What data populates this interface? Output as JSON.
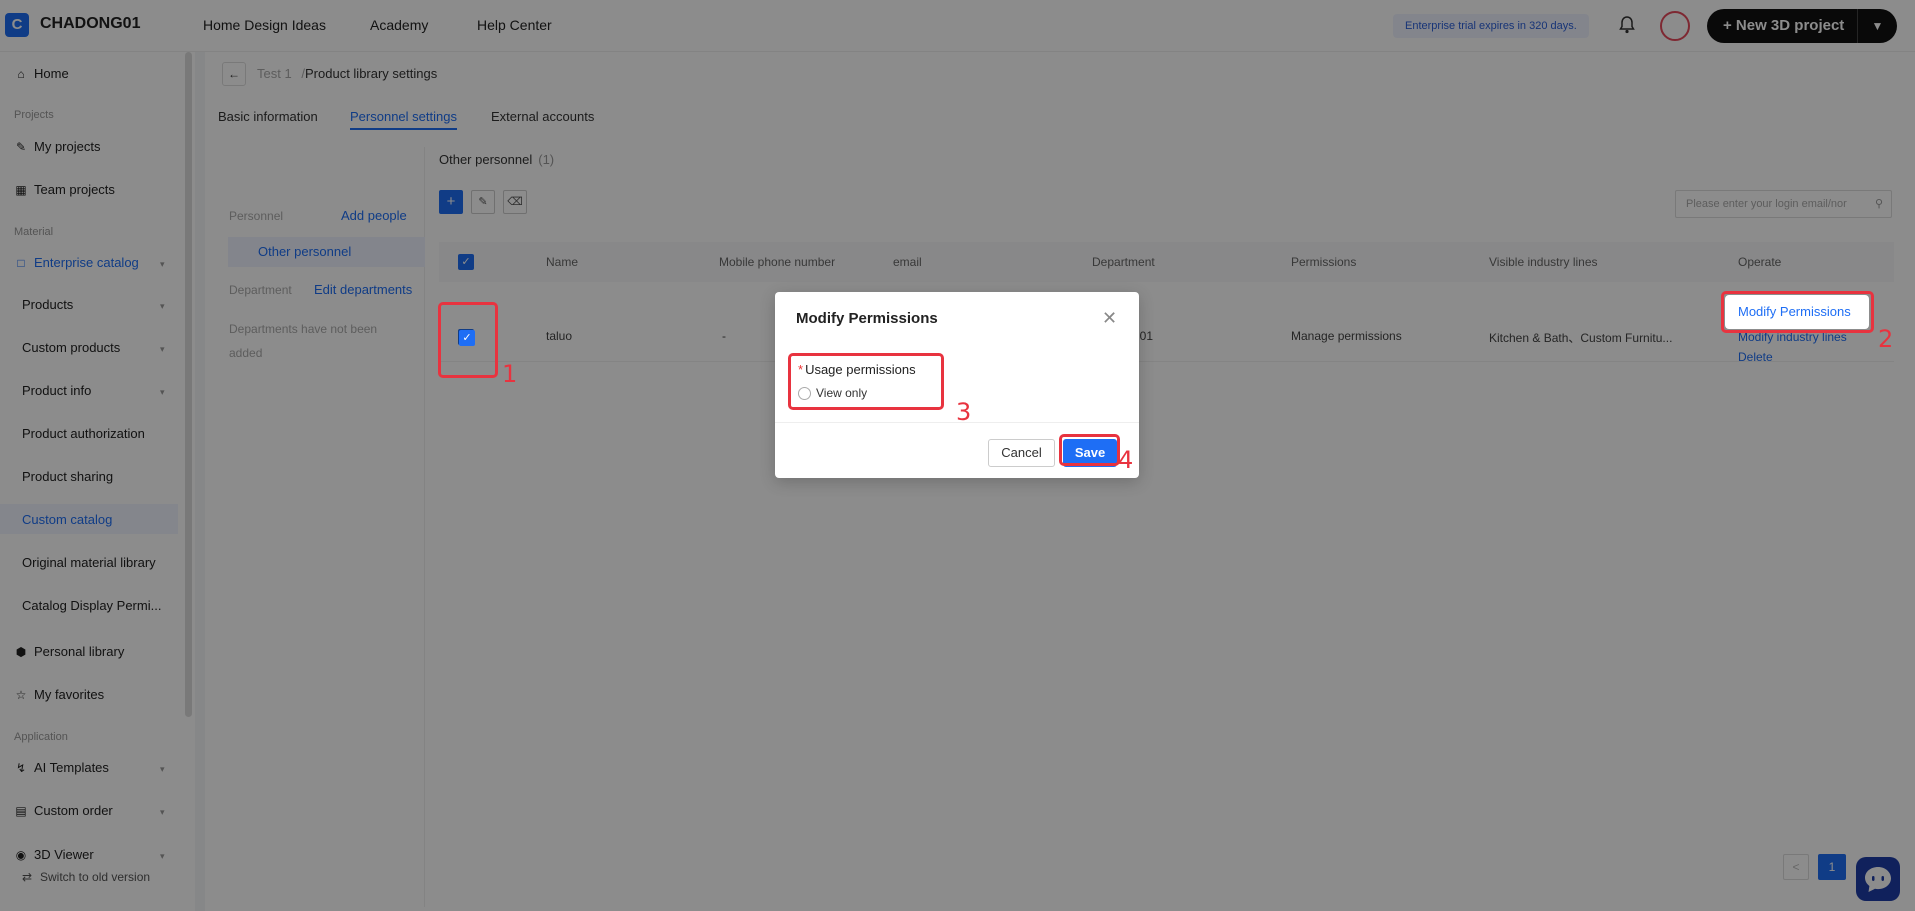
{
  "topbar": {
    "logo_letter": "C",
    "brand": "CHADONG01",
    "nav": [
      "Home Design Ideas",
      "Academy",
      "Help Center"
    ],
    "trial_notice": "Enterprise trial expires in 320 days.",
    "new_project_label": "+ New 3D project"
  },
  "sidebar": {
    "home": "Home",
    "section_projects": "Projects",
    "my_projects": "My projects",
    "team_projects": "Team projects",
    "section_material": "Material",
    "enterprise_catalog": "Enterprise catalog",
    "products": "Products",
    "custom_products": "Custom products",
    "product_info": "Product info",
    "product_authorization": "Product authorization",
    "product_sharing": "Product sharing",
    "custom_catalog": "Custom catalog",
    "original_material_library": "Original material library",
    "catalog_display": "Catalog Display Permi...",
    "personal_library": "Personal library",
    "my_favorites": "My favorites",
    "section_application": "Application",
    "ai_templates": "AI Templates",
    "custom_order": "Custom order",
    "viewer_3d": "3D Viewer",
    "switch_old": "Switch to old version"
  },
  "breadcrumb": {
    "parent": "Test 1",
    "separator": "/",
    "current": "Product library settings"
  },
  "tabs": [
    "Basic information",
    "Personnel settings",
    "External accounts"
  ],
  "left_panel": {
    "personnel_label": "Personnel",
    "add_people": "Add people",
    "other_personnel": "Other personnel",
    "department_label": "Department",
    "edit_departments": "Edit departments",
    "empty_departments": "Departments have not been added"
  },
  "group": {
    "title": "Other personnel",
    "count": "(1)"
  },
  "search": {
    "placeholder": "Please enter your login email/nor"
  },
  "table": {
    "headers": [
      "Name",
      "Mobile phone number",
      "email",
      "Department",
      "Permissions",
      "Visible industry lines",
      "Operate"
    ],
    "row": {
      "name": "taluo",
      "mobile": "-",
      "department": "g01",
      "permissions": "Manage permissions",
      "industry_lines": "Kitchen & Bath、Custom Furnitu...",
      "op_modify_permissions": "Modify Permissions",
      "op_modify_industry": "Modify industry lines",
      "op_delete": "Delete"
    }
  },
  "pager": {
    "prev": "<",
    "current": "1"
  },
  "modal": {
    "title": "Modify Permissions",
    "close": "✕",
    "required_mark": "*",
    "label": "Usage permissions",
    "option": "View only",
    "cancel": "Cancel",
    "save": "Save"
  },
  "annotations": [
    "1",
    "2",
    "3",
    "4"
  ],
  "colors": {
    "accent": "#1e6ef5",
    "annotation": "#e8333f"
  }
}
